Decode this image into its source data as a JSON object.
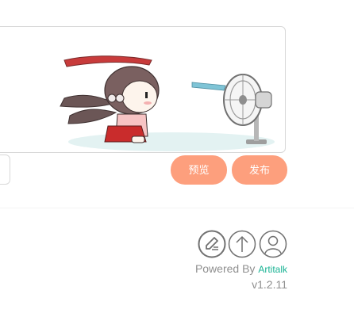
{
  "editor": {
    "image_alt": "girl blown by electric fan animation"
  },
  "buttons": {
    "preview": "预览",
    "send": "发布"
  },
  "toolbar": {
    "icons": [
      "edit-icon",
      "arrow-up-icon",
      "user-icon"
    ]
  },
  "footer": {
    "powered_prefix": "Powered By ",
    "powered_brand": "Artitalk",
    "version": "v1.2.11"
  },
  "colors": {
    "button": "#fd9f7d",
    "brand": "#1ab394",
    "muted_text": "#8f8f8f",
    "border": "#d8d8d8"
  }
}
